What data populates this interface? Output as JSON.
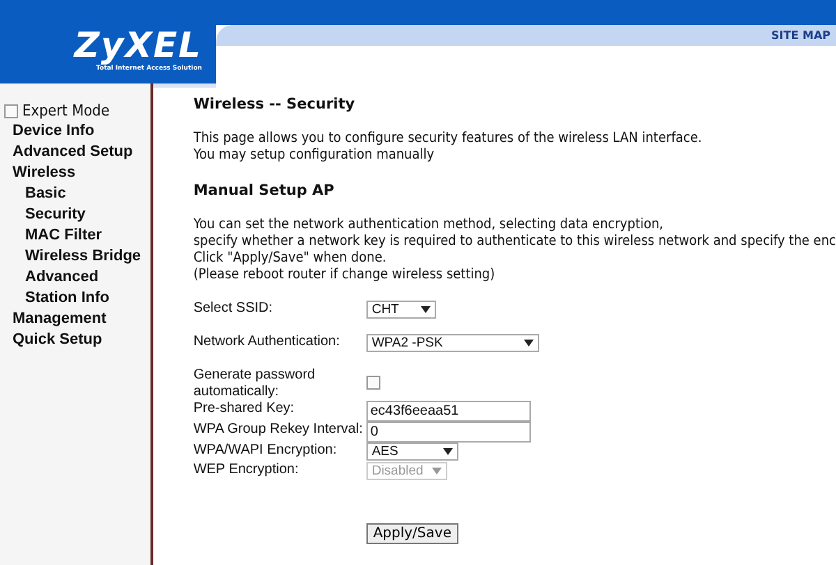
{
  "header": {
    "logo": "ZyXEL",
    "tagline": "Total Internet Access Solution",
    "site_map": "SITE MAP"
  },
  "sidebar": {
    "expert_mode": {
      "label": "Expert Mode",
      "checked": false
    },
    "items": [
      {
        "label": "Device Info"
      },
      {
        "label": "Advanced Setup"
      },
      {
        "label": "Wireless",
        "children": [
          {
            "label": "Basic"
          },
          {
            "label": "Security"
          },
          {
            "label": "MAC Filter"
          },
          {
            "label": "Wireless Bridge"
          },
          {
            "label": "Advanced"
          },
          {
            "label": "Station Info"
          }
        ]
      },
      {
        "label": "Management"
      },
      {
        "label": "Quick Setup"
      }
    ]
  },
  "title": "Wireless -- Security",
  "intro": [
    "This page allows you to configure security features of the wireless LAN interface.",
    "You may setup configuration manually"
  ],
  "section_title": "Manual Setup AP",
  "description": [
    "You can set the network authentication method, selecting data encryption,",
    "specify whether a network key is required to authenticate to this wireless network and specify the enc",
    "Click \"Apply/Save\" when done.",
    "(Please reboot router if change wireless setting)"
  ],
  "fields": [
    {
      "kind": "select",
      "label": "Select SSID:",
      "value": "CHT",
      "disabled": false
    },
    {
      "kind": "select",
      "label": "Network Authentication:",
      "value": "WPA2 -PSK",
      "disabled": false
    },
    {
      "kind": "checkbox",
      "label": "Generate password automatically:",
      "checked": false
    },
    {
      "kind": "text",
      "label": "Pre-shared Key:",
      "value": "ec43f6eeaa51"
    },
    {
      "kind": "text",
      "label": "WPA Group Rekey Interval:",
      "value": "0"
    },
    {
      "kind": "select",
      "label": "WPA/WAPI Encryption:",
      "value": "AES",
      "disabled": false
    },
    {
      "kind": "select",
      "label": "WEP Encryption:",
      "value": "Disabled",
      "disabled": true
    }
  ],
  "apply_button": "Apply/Save"
}
